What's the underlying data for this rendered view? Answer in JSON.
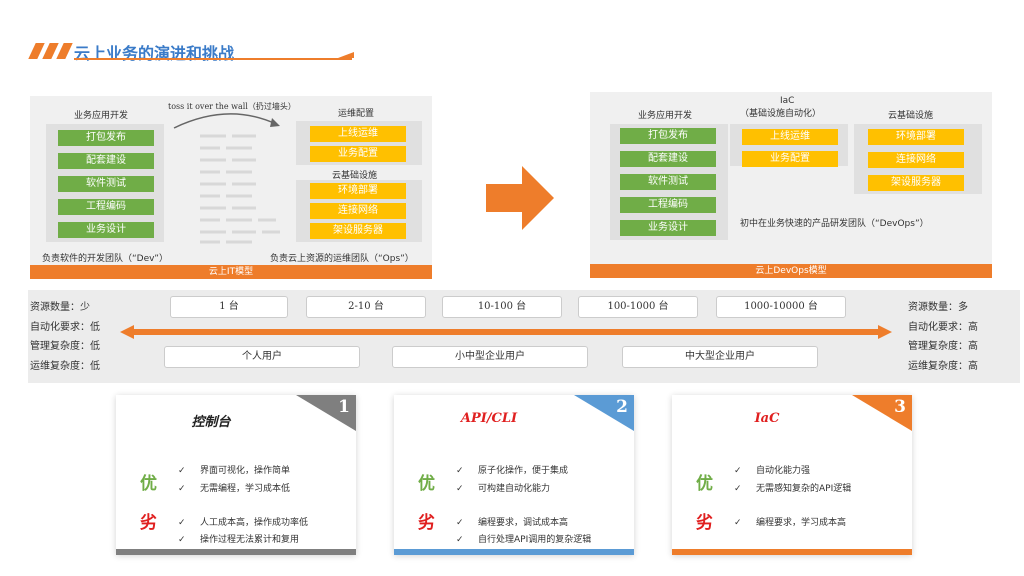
{
  "header": {
    "title": "云上业务的演进和挑战"
  },
  "it_model": {
    "col1_title": "业务应用开发",
    "col1_items": [
      "打包发布",
      "配套建设",
      "软件测试",
      "工程编码",
      "业务设计"
    ],
    "wall_text": "toss it over the wall（扔过墙头）",
    "ops_title": "运维配置",
    "ops_items": [
      "上线运维",
      "业务配置"
    ],
    "infra_title": "云基础设施",
    "infra_items": [
      "环境部署",
      "连接网络",
      "架设服务器"
    ],
    "dev_team": "负责软件的开发团队（“Dev”）",
    "ops_team": "负责云上资源的运维团队（“Ops”）",
    "bar_label": "云上IT模型"
  },
  "devops_model": {
    "col1_title": "业务应用开发",
    "col1_items": [
      "打包发布",
      "配套建设",
      "软件测试",
      "工程编码",
      "业务设计"
    ],
    "iac_title_1": "IaC",
    "iac_title_2": "（基础设施自动化）",
    "iac_items": [
      "上线运维",
      "业务配置"
    ],
    "infra_title": "云基础设施",
    "infra_items": [
      "环境部署",
      "连接网络",
      "架设服务器"
    ],
    "team_note": "初中在业务快速的产品研发团队（“DevOps”）",
    "bar_label": "云上DevOps模型"
  },
  "scale": {
    "counts": [
      "1 台",
      "2-10 台",
      "10-100 台",
      "100-1000 台",
      "1000-10000 台"
    ],
    "users": [
      "个人用户",
      "小中型企业用户",
      "中大型企业用户"
    ],
    "left": [
      "资源数量：少",
      "自动化要求：低",
      "管理复杂度：低",
      "运维复杂度：低"
    ],
    "right": [
      "资源数量：多",
      "自动化要求：高",
      "管理复杂度：高",
      "运维复杂度：高"
    ]
  },
  "cards": [
    {
      "title": "控制台",
      "num": "1",
      "accent": "#7f7f7f",
      "title_color": "#222222",
      "pro_label": "优",
      "pros": [
        "界面可视化，操作简单",
        "无需编程，学习成本低"
      ],
      "con_label": "劣",
      "cons": [
        "人工成本高，操作成功率低",
        "操作过程无法累计和复用"
      ]
    },
    {
      "title": "API/CLI",
      "num": "2",
      "accent": "#5b9bd5",
      "title_color": "#e02020",
      "pro_label": "优",
      "pros": [
        "原子化操作，便于集成",
        "可构建自动化能力"
      ],
      "con_label": "劣",
      "cons": [
        "编程要求，调试成本高",
        "自行处理API调用的复杂逻辑"
      ]
    },
    {
      "title": "IaC",
      "num": "3",
      "accent": "#ee7d2b",
      "title_color": "#e02020",
      "pro_label": "优",
      "pros": [
        "自动化能力强",
        "无需感知复杂的API逻辑"
      ],
      "con_label": "劣",
      "cons": [
        "编程要求，学习成本高"
      ]
    }
  ],
  "colors": {
    "orange": "#ee7d2b",
    "green": "#70ad47",
    "yellow": "#ffc000",
    "blue": "#3a7bc8"
  }
}
